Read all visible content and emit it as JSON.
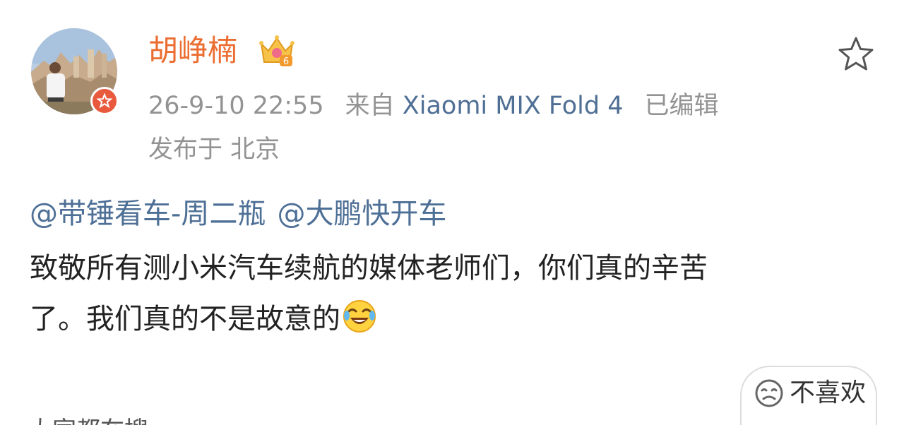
{
  "post": {
    "author": {
      "name": "胡峥楠",
      "avatar": "avatar-photo",
      "badge": "verified-badge-icon",
      "level_icon": "crown-icon"
    },
    "meta": {
      "time": "26-9-10 22:55",
      "source_prefix": "来自",
      "device": "Xiaomi MIX Fold 4",
      "edited": "已编辑",
      "location": "发布于 北京"
    },
    "mentions": [
      "@带锤看车-周二瓶",
      "@大鹏快开车"
    ],
    "body_line1": "致敬所有测小米汽车续航的媒体老师们，你们真的辛苦",
    "body_line2": "了。我们真的不是故意的",
    "emoji": "laugh-crying-icon",
    "actions": {
      "dislike_label": "不喜欢",
      "favorite_icon": "star-icon"
    },
    "partial_bottom_text": "大家都在搜"
  },
  "colors": {
    "username": "#ec6d31",
    "meta": "#939393",
    "link": "#4e6f96",
    "body": "#222222",
    "badge": "#e8593d"
  }
}
